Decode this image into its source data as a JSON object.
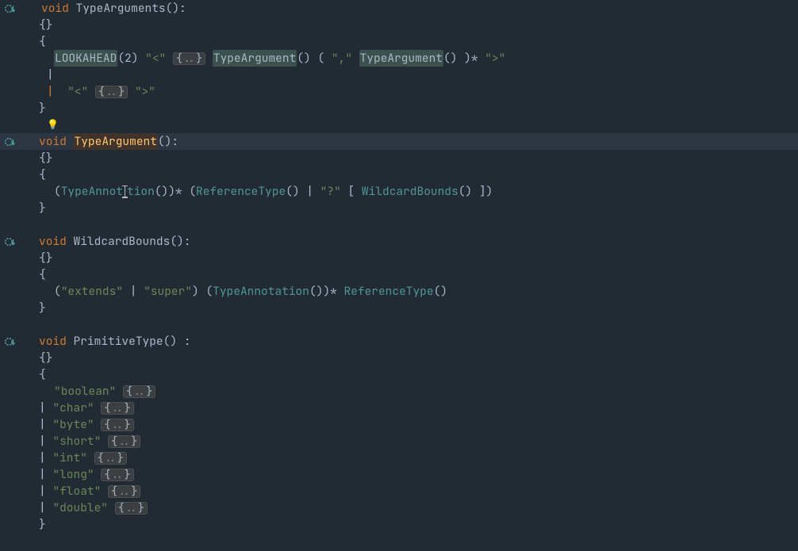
{
  "tokens": {
    "void": "void",
    "lookahead": "LOOKAHEAD",
    "two": "2",
    "lt": "\"<\"",
    "gt": "\">\"",
    "comma": "\",\"",
    "qmark": "\"?\"",
    "extends": "\"extends\"",
    "super": "\"super\"",
    "boolean": "\"boolean\"",
    "char": "\"char\"",
    "byte": "\"byte\"",
    "short": "\"short\"",
    "int": "\"int\"",
    "long": "\"long\"",
    "float": "\"float\"",
    "double": "\"double\"",
    "typeArguments": "TypeArguments",
    "typeArgument": "TypeArgument",
    "typeAnnot_left": "TypeAnnot",
    "typeAnnot_right": "tion",
    "typeAnnotation": "TypeAnnotation",
    "referenceType": "ReferenceType",
    "wildcardBounds": "WildcardBounds",
    "primitiveType": "PrimitiveType",
    "fold_dots": "..",
    "obrace": "{",
    "cbrace": "}",
    "emptyBraces": "{}",
    "pipe": "|",
    "colon": ":",
    "oparen": "(",
    "cparen": ")",
    "obrack": "[",
    "cbrack": "]",
    "star": "*"
  }
}
